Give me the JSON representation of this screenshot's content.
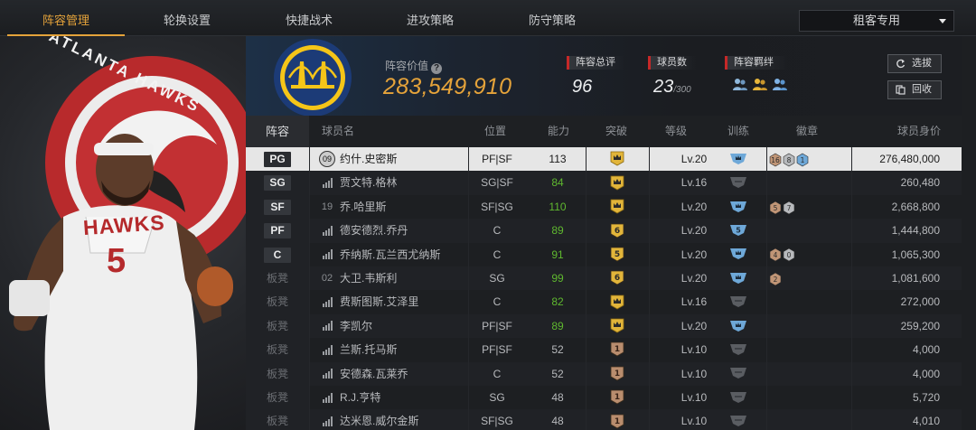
{
  "nav": {
    "tabs": [
      "阵容管理",
      "轮换设置",
      "快捷战术",
      "进攻策略",
      "防守策略"
    ],
    "active": 0,
    "dropdown_value": "租客专用"
  },
  "header": {
    "value_label": "阵容价值",
    "value_amount": "283,549,910",
    "overall_label": "阵容总评",
    "overall_value": "96",
    "player_count_label": "球员数",
    "player_count_value": "23",
    "player_count_max": "/300",
    "bond_label": "阵容羁绊",
    "select_button": "选拔",
    "recycle_button": "回收"
  },
  "table": {
    "columns": [
      "阵容",
      "球员名",
      "位置",
      "能力",
      "突破",
      "等级",
      "训练",
      "徽章",
      "球员身价"
    ],
    "rows": [
      {
        "slot": "PG",
        "starter": true,
        "jersey": "09",
        "name": "约什.史密斯",
        "position": "PF|SF",
        "ability": "113",
        "ability_green": false,
        "break": "crown",
        "level": "Lv.20",
        "training": "blue",
        "badges": [
          "16",
          "8",
          "1"
        ],
        "price": "276,480,000",
        "selected": true
      },
      {
        "slot": "SG",
        "starter": true,
        "jersey": "",
        "name": "贾文特.格林",
        "position": "SG|SF",
        "ability": "84",
        "ability_green": true,
        "break": "crown",
        "level": "Lv.16",
        "training": "gray",
        "badges": [],
        "price": "260,480",
        "selected": false
      },
      {
        "slot": "SF",
        "starter": true,
        "jersey": "19",
        "name": "乔.哈里斯",
        "position": "SF|SG",
        "ability": "110",
        "ability_green": true,
        "break": "crown",
        "level": "Lv.20",
        "training": "blue",
        "badges": [
          "5",
          "7"
        ],
        "price": "2,668,800",
        "selected": false
      },
      {
        "slot": "PF",
        "starter": true,
        "jersey": "",
        "name": "德安德烈.乔丹",
        "position": "C",
        "ability": "89",
        "ability_green": true,
        "break": "6",
        "level": "Lv.20",
        "training": "5",
        "badges": [],
        "price": "1,444,800",
        "selected": false
      },
      {
        "slot": "C",
        "starter": true,
        "jersey": "",
        "name": "乔纳斯.瓦兰西尤纳斯",
        "position": "C",
        "ability": "91",
        "ability_green": true,
        "break": "5",
        "level": "Lv.20",
        "training": "blue",
        "badges": [
          "4",
          "0"
        ],
        "price": "1,065,300",
        "selected": false
      },
      {
        "slot": "板凳",
        "starter": false,
        "jersey": "02",
        "name": "大卫.韦斯利",
        "position": "SG",
        "ability": "99",
        "ability_green": true,
        "break": "6",
        "level": "Lv.20",
        "training": "blue",
        "badges": [
          "2"
        ],
        "price": "1,081,600",
        "selected": false
      },
      {
        "slot": "板凳",
        "starter": false,
        "jersey": "",
        "name": "费斯图斯.艾泽里",
        "position": "C",
        "ability": "82",
        "ability_green": true,
        "break": "crown",
        "level": "Lv.16",
        "training": "gray",
        "badges": [],
        "price": "272,000",
        "selected": false
      },
      {
        "slot": "板凳",
        "starter": false,
        "jersey": "",
        "name": "李凯尔",
        "position": "PF|SF",
        "ability": "89",
        "ability_green": true,
        "break": "crown",
        "level": "Lv.20",
        "training": "blue",
        "badges": [],
        "price": "259,200",
        "selected": false
      },
      {
        "slot": "板凳",
        "starter": false,
        "jersey": "",
        "name": "兰斯.托马斯",
        "position": "PF|SF",
        "ability": "52",
        "ability_green": false,
        "break": "1",
        "level": "Lv.10",
        "training": "gray",
        "badges": [],
        "price": "4,000",
        "selected": false
      },
      {
        "slot": "板凳",
        "starter": false,
        "jersey": "",
        "name": "安德森.瓦莱乔",
        "position": "C",
        "ability": "52",
        "ability_green": false,
        "break": "1",
        "level": "Lv.10",
        "training": "gray",
        "badges": [],
        "price": "4,000",
        "selected": false
      },
      {
        "slot": "板凳",
        "starter": false,
        "jersey": "",
        "name": "R.J.亨特",
        "position": "SG",
        "ability": "48",
        "ability_green": false,
        "break": "1",
        "level": "Lv.10",
        "training": "gray",
        "badges": [],
        "price": "5,720",
        "selected": false
      },
      {
        "slot": "板凳",
        "starter": false,
        "jersey": "",
        "name": "达米恩.威尔金斯",
        "position": "SF|SG",
        "ability": "48",
        "ability_green": false,
        "break": "1",
        "level": "Lv.10",
        "training": "gray",
        "badges": [],
        "price": "4,010",
        "selected": false
      }
    ]
  },
  "art": {
    "team_text": "ATLANTA HAWKS",
    "jersey_text": "HAWKS",
    "jersey_number": "5"
  },
  "colors": {
    "accent": "#e5a33a",
    "green": "#5fb82f",
    "red_label": "#c62828",
    "blue_train": "#6ea8d8"
  }
}
